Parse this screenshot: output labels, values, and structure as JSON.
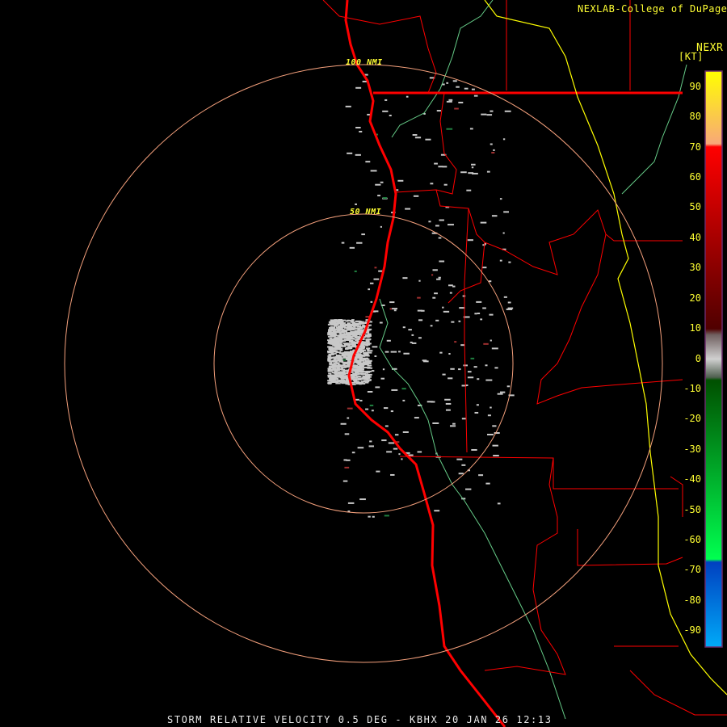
{
  "header": {
    "credit": "NEXLAB-College of DuPage",
    "credit_icon": "nexlab-logo-icon",
    "product": "NEXR",
    "units": "[KT]"
  },
  "map": {
    "radar_site": "KBHX",
    "range_rings": [
      {
        "label": "50 NMI",
        "nmi": 50
      },
      {
        "label": "100 NMI",
        "nmi": 100
      }
    ],
    "colors": {
      "range_ring": "#f4a07c",
      "ring_label": "#ffff33",
      "coastline_and_borders": "#ff0000",
      "state_line": "#ffff00",
      "rivers": "#66cc88",
      "echo_gray": "#c8c8c8"
    }
  },
  "colorbar": {
    "unit": "KT",
    "range": [
      -95,
      95
    ],
    "ticks": [
      "90",
      "80",
      "70",
      "60",
      "50",
      "40",
      "30",
      "20",
      "10",
      "0",
      "-10",
      "-20",
      "-30",
      "-40",
      "-50",
      "-60",
      "-70",
      "-80",
      "-90"
    ],
    "stops": [
      {
        "value": 95,
        "color": "#ffff00"
      },
      {
        "value": 71,
        "color": "#f8a878"
      },
      {
        "value": 70,
        "color": "#ff0000"
      },
      {
        "value": 10,
        "color": "#500000"
      },
      {
        "value": 8,
        "color": "#706060"
      },
      {
        "value": 0,
        "color": "#d0d0d0"
      },
      {
        "value": -6,
        "color": "#506050"
      },
      {
        "value": -7,
        "color": "#005000"
      },
      {
        "value": -66,
        "color": "#00ff50"
      },
      {
        "value": -67,
        "color": "#0040c0"
      },
      {
        "value": -95,
        "color": "#00aaf8"
      }
    ]
  },
  "footer": {
    "caption": "STORM RELATIVE VELOCITY 0.5 DEG - KBHX 20 JAN 26 12:13"
  }
}
